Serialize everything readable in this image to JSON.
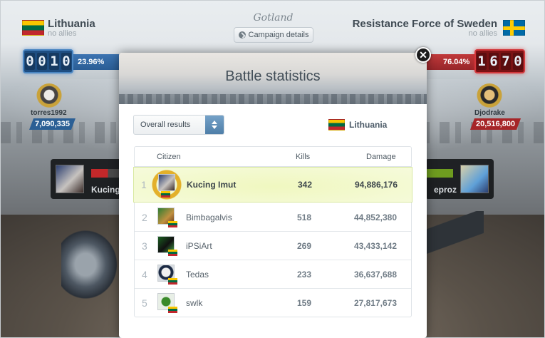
{
  "campaign": {
    "title": "Gotland",
    "details_label": "Campaign details"
  },
  "left_side": {
    "country": "Lithuania",
    "allies": "no allies",
    "score_digits": [
      "0",
      "0",
      "1",
      "0"
    ],
    "domination": "23.96%",
    "hero_name": "torres1992",
    "hero_damage": "7,090,335",
    "fighter_name": "Kucing"
  },
  "right_side": {
    "country": "Resistance Force of Sweden",
    "allies": "no allies",
    "score_digits": [
      "1",
      "6",
      "7",
      "0"
    ],
    "domination": "76.04%",
    "hero_name": "Djodrake",
    "hero_damage": "20,516,800",
    "fighter_name": "eproz"
  },
  "modal": {
    "title": "Battle statistics",
    "close_icon": "close-icon",
    "filter": {
      "selected": "Overall results"
    },
    "country": "Lithuania",
    "columns": {
      "citizen": "Citizen",
      "kills": "Kills",
      "damage": "Damage"
    },
    "rows": [
      {
        "rank": "1",
        "name": "Kucing Imut",
        "kills": "342",
        "damage": "94,886,176"
      },
      {
        "rank": "2",
        "name": "Bimbagalvis",
        "kills": "518",
        "damage": "44,852,380"
      },
      {
        "rank": "3",
        "name": "iPSiArt",
        "kills": "269",
        "damage": "43,433,142"
      },
      {
        "rank": "4",
        "name": "Tedas",
        "kills": "233",
        "damage": "36,637,688"
      },
      {
        "rank": "5",
        "name": "swlk",
        "kills": "159",
        "damage": "27,817,673"
      }
    ]
  },
  "colors": {
    "lithuania": "#2b5f95",
    "sweden": "#a62528",
    "highlight": "#f3f9cf"
  }
}
